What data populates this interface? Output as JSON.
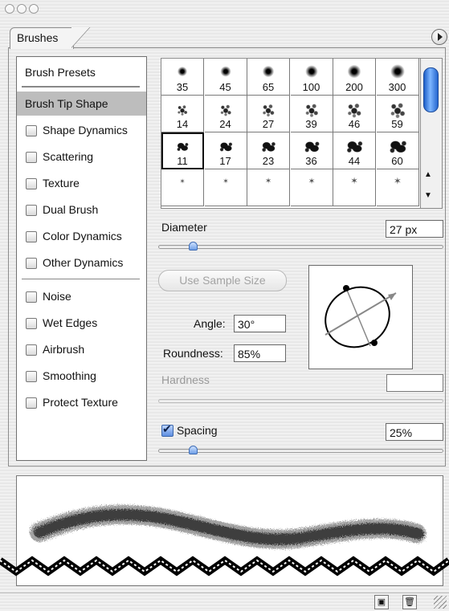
{
  "panel": {
    "tab_label": "Brushes"
  },
  "sidebar": {
    "items": [
      {
        "label": "Brush Presets",
        "checkbox": false,
        "selected": false
      },
      {
        "label": "Brush Tip Shape",
        "checkbox": false,
        "selected": true
      },
      {
        "label": "Shape Dynamics",
        "checkbox": true,
        "selected": false
      },
      {
        "label": "Scattering",
        "checkbox": true,
        "selected": false
      },
      {
        "label": "Texture",
        "checkbox": true,
        "selected": false
      },
      {
        "label": "Dual Brush",
        "checkbox": true,
        "selected": false
      },
      {
        "label": "Color Dynamics",
        "checkbox": true,
        "selected": false
      },
      {
        "label": "Other Dynamics",
        "checkbox": true,
        "selected": false
      },
      {
        "label": "Noise",
        "checkbox": true,
        "selected": false
      },
      {
        "label": "Wet Edges",
        "checkbox": true,
        "selected": false
      },
      {
        "label": "Airbrush",
        "checkbox": true,
        "selected": false
      },
      {
        "label": "Smoothing",
        "checkbox": true,
        "selected": false
      },
      {
        "label": "Protect Texture",
        "checkbox": true,
        "selected": false
      }
    ]
  },
  "presets": {
    "rows": [
      {
        "style": "soft",
        "sizes": [
          "35",
          "45",
          "65",
          "100",
          "200",
          "300"
        ]
      },
      {
        "style": "splat",
        "sizes": [
          "14",
          "24",
          "27",
          "39",
          "46",
          "59"
        ]
      },
      {
        "style": "chalk",
        "sizes": [
          "11",
          "17",
          "23",
          "36",
          "44",
          "60"
        ]
      },
      {
        "style": "star",
        "sizes": [
          "",
          "",
          "",
          "",
          "",
          ""
        ]
      }
    ],
    "selected_row": 2,
    "selected_col": 0
  },
  "tip": {
    "diameter_label": "Diameter",
    "diameter_value": "27 px",
    "diameter_slider_fraction": 0.12,
    "use_sample_size_label": "Use Sample Size",
    "angle_label": "Angle:",
    "angle_value": "30°",
    "roundness_label": "Roundness:",
    "roundness_value": "85%",
    "hardness_label": "Hardness",
    "hardness_value": "",
    "spacing_label": "Spacing",
    "spacing_checked": true,
    "spacing_value": "25%",
    "spacing_slider_fraction": 0.12
  },
  "icons": {
    "panel_menu": "panel-menu-arrow-icon",
    "new_brush": "new-brush-icon",
    "trash": "trash-icon",
    "resize": "resize-grip-icon"
  }
}
